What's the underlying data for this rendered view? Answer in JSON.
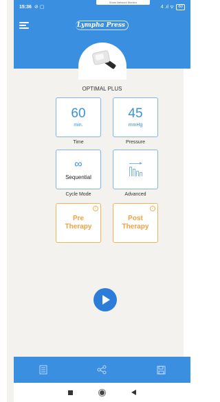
{
  "status_bar": {
    "time": "15:36",
    "left_icons": "⊘ ▢",
    "banner_text": "Show Network Monitor",
    "signal_text": "4 .ıl ᯤ",
    "battery": "60"
  },
  "app_bar": {
    "app_title": "Lympha Press",
    "menu_icon": "hamburger-menu-icon"
  },
  "device": {
    "model_name": "OPTIMAL PLUS"
  },
  "settings": {
    "time": {
      "value": "60",
      "unit": "min.",
      "caption": "Time"
    },
    "pressure": {
      "value": "45",
      "unit": "mmHg",
      "caption": "Pressure"
    },
    "cycle_mode": {
      "icon": "infinity-icon",
      "glyph": "∞",
      "value": "Sequential",
      "caption": "Cycle Mode"
    },
    "advanced": {
      "icon": "advanced-chart-icon",
      "caption": "Advanced"
    }
  },
  "therapy": {
    "pre": {
      "label": "Pre\nTherapy",
      "check_icon": "checkmark-circle-icon"
    },
    "post": {
      "label": "Post\nTherapy",
      "check_icon": "checkmark-circle-icon"
    }
  },
  "controls": {
    "play_icon": "play-icon"
  },
  "bottom_bar": {
    "items": [
      "list-document-icon",
      "share-icon",
      "save-icon"
    ]
  },
  "colors": {
    "primary": "#3b8fe0",
    "accent": "#f0a040",
    "background": "#f4f2ef"
  }
}
